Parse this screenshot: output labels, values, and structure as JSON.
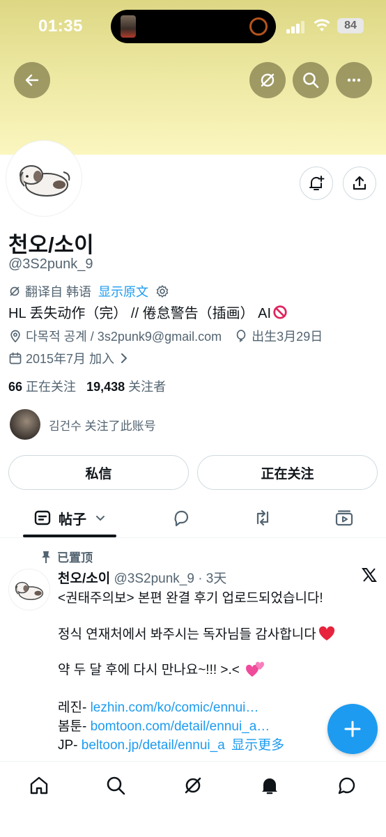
{
  "status_bar": {
    "time": "01:35",
    "battery": "84"
  },
  "profile": {
    "name": "천오/소이",
    "handle": "@3S2punk_9",
    "translate_prefix": "翻译自 韩语",
    "translate_link": "显示原文",
    "bio": "HL 丢失动作（完） // 倦怠警告（插画） AI",
    "location": "다목적 공계 / 3s2punk9@gmail.com",
    "birthday": "出生3月29日",
    "joined": "2015年7月 加入",
    "following_count": "66",
    "following_label": "正在关注",
    "followers_count": "19,438",
    "followers_label": "关注者",
    "followed_by": "김건수 关注了此账号"
  },
  "actions": {
    "message": "私信",
    "following": "正在关注"
  },
  "tabs": {
    "posts": "帖子"
  },
  "post": {
    "pinned_label": "已置顶",
    "author_name": "천오/소이",
    "author_meta": "@3S2punk_9 · 3天",
    "line1": "<권태주의보> 본편 완결 후기 업로드되었습니다!",
    "line2": "정식 연재처에서 봐주시는 독자님들 감사합니다",
    "line3": "약 두 달 후에 다시 만나요~!!! >.<",
    "link1_prefix": "레진- ",
    "link1": "lezhin.com/ko/comic/ennui…",
    "link2_prefix": "봄툰- ",
    "link2": "bomtoon.com/detail/ennui_a…",
    "link3_prefix": "JP- ",
    "link3": "beltoon.jp/detail/ennui_a",
    "show_more": "显示更多"
  },
  "colors": {
    "accent": "#1d9bf0",
    "banner": "#ece7a0",
    "text": "#0f1419",
    "muted": "#536471"
  }
}
